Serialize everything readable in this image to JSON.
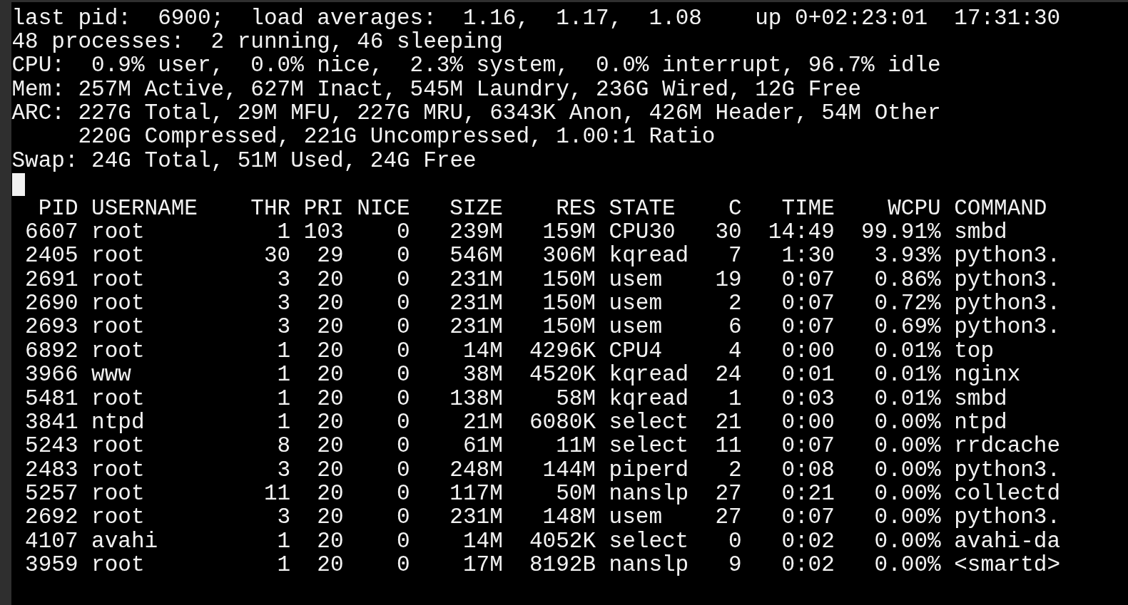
{
  "summary_lines": [
    {
      "text": "last pid:  6900;  load averages:  1.16,  1.17,  1.08    up 0+02:23:01  17:31:30"
    },
    {
      "text": "48 processes:  2 running, 46 sleeping"
    },
    {
      "text": "CPU:  0.9% user,  0.0% nice,  2.3% system,  0.0% interrupt, 96.7% idle"
    },
    {
      "text": "Mem: 257M Active, 627M Inact, 545M Laundry, 236G Wired, 12G Free"
    },
    {
      "text": "ARC: 227G Total, 29M MFU, 227G MRU, 6343K Anon, 426M Header, 54M Other",
      "continuation": "220G Compressed, 221G Uncompressed, 1.00:1 Ratio"
    },
    {
      "text": "Swap: 24G Total, 51M Used, 24G Free"
    }
  ],
  "process_table": {
    "columns": [
      "PID",
      "USERNAME",
      "THR",
      "PRI",
      "NICE",
      "SIZE",
      "RES",
      "STATE",
      "C",
      "TIME",
      "WCPU",
      "COMMAND"
    ],
    "rows": [
      [
        "6607",
        "root",
        "1",
        "103",
        "0",
        "239M",
        "159M",
        "CPU30",
        "30",
        "14:49",
        "99.91%",
        "smbd"
      ],
      [
        "2405",
        "root",
        "30",
        "29",
        "0",
        "546M",
        "306M",
        "kqread",
        "7",
        "1:30",
        "3.93%",
        "python3."
      ],
      [
        "2691",
        "root",
        "3",
        "20",
        "0",
        "231M",
        "150M",
        "usem",
        "19",
        "0:07",
        "0.86%",
        "python3."
      ],
      [
        "2690",
        "root",
        "3",
        "20",
        "0",
        "231M",
        "150M",
        "usem",
        "2",
        "0:07",
        "0.72%",
        "python3."
      ],
      [
        "2693",
        "root",
        "3",
        "20",
        "0",
        "231M",
        "150M",
        "usem",
        "6",
        "0:07",
        "0.69%",
        "python3."
      ],
      [
        "6892",
        "root",
        "1",
        "20",
        "0",
        "14M",
        "4296K",
        "CPU4",
        "4",
        "0:00",
        "0.01%",
        "top"
      ],
      [
        "3966",
        "www",
        "1",
        "20",
        "0",
        "38M",
        "4520K",
        "kqread",
        "24",
        "0:01",
        "0.01%",
        "nginx"
      ],
      [
        "5481",
        "root",
        "1",
        "20",
        "0",
        "138M",
        "58M",
        "kqread",
        "1",
        "0:03",
        "0.01%",
        "smbd"
      ],
      [
        "3841",
        "ntpd",
        "1",
        "20",
        "0",
        "21M",
        "6080K",
        "select",
        "21",
        "0:00",
        "0.00%",
        "ntpd"
      ],
      [
        "5243",
        "root",
        "8",
        "20",
        "0",
        "61M",
        "11M",
        "select",
        "11",
        "0:07",
        "0.00%",
        "rrdcache"
      ],
      [
        "2483",
        "root",
        "3",
        "20",
        "0",
        "248M",
        "144M",
        "piperd",
        "2",
        "0:08",
        "0.00%",
        "python3."
      ],
      [
        "5257",
        "root",
        "11",
        "20",
        "0",
        "117M",
        "50M",
        "nanslp",
        "27",
        "0:21",
        "0.00%",
        "collectd"
      ],
      [
        "2692",
        "root",
        "3",
        "20",
        "0",
        "231M",
        "148M",
        "usem",
        "27",
        "0:07",
        "0.00%",
        "python3."
      ],
      [
        "4107",
        "avahi",
        "1",
        "20",
        "0",
        "14M",
        "4052K",
        "select",
        "0",
        "0:02",
        "0.00%",
        "avahi-da"
      ],
      [
        "3959",
        "root",
        "1",
        "20",
        "0",
        "17M",
        "8192B",
        "nanslp",
        "9",
        "0:02",
        "0.00%",
        "<smartd>"
      ]
    ]
  }
}
